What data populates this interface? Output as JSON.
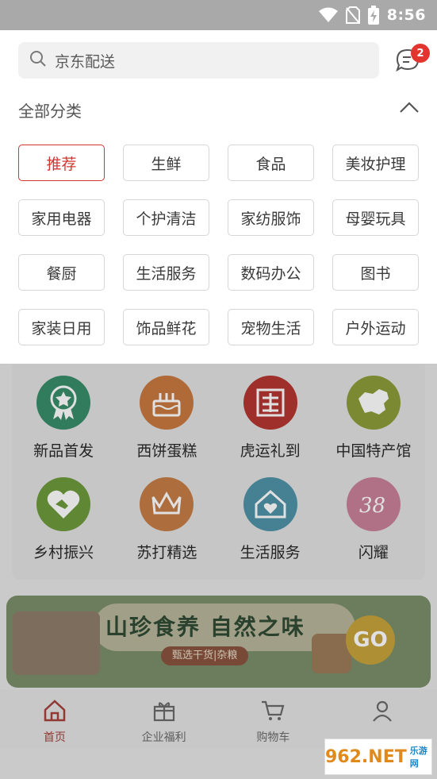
{
  "status_bar": {
    "time": "8:56"
  },
  "search": {
    "text": "京东配送"
  },
  "messages": {
    "badge": "2"
  },
  "panel": {
    "title": "全部分类"
  },
  "categories": [
    {
      "label": "推荐",
      "selected": true
    },
    {
      "label": "生鲜"
    },
    {
      "label": "食品"
    },
    {
      "label": "美妆护理"
    },
    {
      "label": "家用电器"
    },
    {
      "label": "个护清洁"
    },
    {
      "label": "家纺服饰"
    },
    {
      "label": "母婴玩具"
    },
    {
      "label": "餐厨"
    },
    {
      "label": "生活服务"
    },
    {
      "label": "数码办公"
    },
    {
      "label": "图书"
    },
    {
      "label": "家装日用"
    },
    {
      "label": "饰品鲜花"
    },
    {
      "label": "宠物生活"
    },
    {
      "label": "户外运动"
    }
  ],
  "grid": [
    {
      "label": "新品首发",
      "icon": "medal-icon",
      "color": "#3a8e6b"
    },
    {
      "label": "西饼蛋糕",
      "icon": "cake-icon",
      "color": "#c9793f"
    },
    {
      "label": "虎运礼到",
      "icon": "gift-box-icon",
      "color": "#b53631"
    },
    {
      "label": "中国特产馆",
      "icon": "china-map-icon",
      "color": "#8e9d3b"
    },
    {
      "label": "乡村振兴",
      "icon": "handshake-heart-icon",
      "color": "#6d9a3c"
    },
    {
      "label": "苏打精选",
      "icon": "crown-icon",
      "color": "#c57d46"
    },
    {
      "label": "生活服务",
      "icon": "house-heart-icon",
      "color": "#4f92a8"
    },
    {
      "label": "闪耀",
      "icon": "38-icon",
      "color": "#c9819a"
    }
  ],
  "promo": {
    "title": "山珍食养 自然之味",
    "subtitle": "甄选干货|杂粮",
    "go": "GO"
  },
  "bottom_nav": [
    {
      "label": "首页",
      "icon": "home-icon",
      "active": true
    },
    {
      "label": "企业福利",
      "icon": "gift-icon"
    },
    {
      "label": "购物车",
      "icon": "cart-icon"
    },
    {
      "label": "",
      "icon": "user-icon"
    }
  ],
  "watermark": {
    "text": "962.NET",
    "sub": "乐游网"
  },
  "colors": {
    "accent": "#d0372f",
    "badge": "#e3352f"
  }
}
